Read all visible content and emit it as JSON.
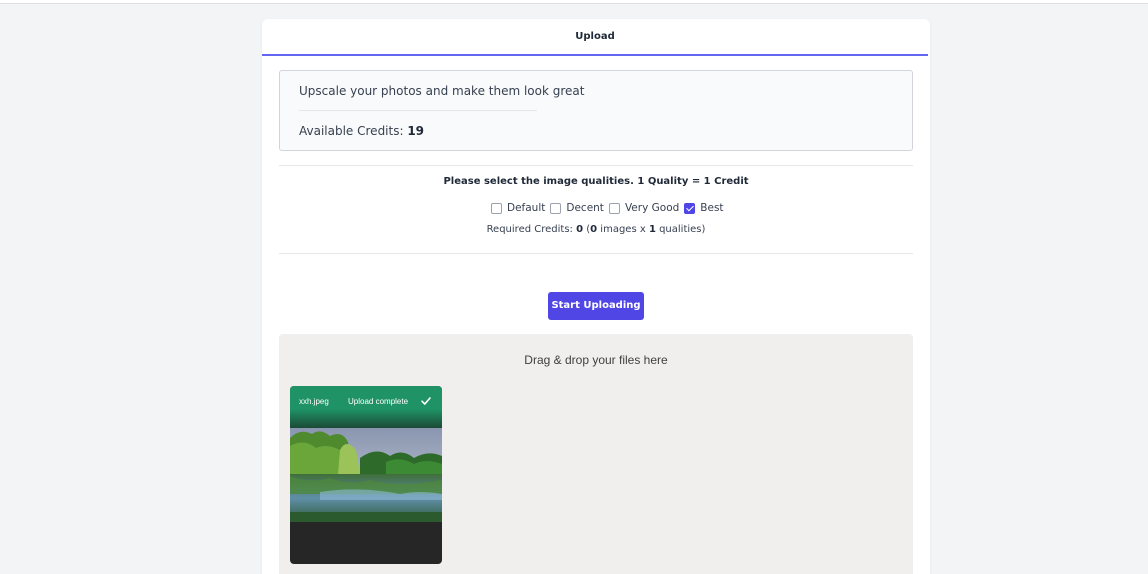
{
  "tabs": [
    {
      "label": "Upload"
    }
  ],
  "info": {
    "title": "Upscale your photos and make them look great",
    "credits_label": "Available Credits: ",
    "credits_value": "19"
  },
  "quality": {
    "heading": "Please select the image qualities. 1 Quality = 1 Credit",
    "options": [
      {
        "label": "Default",
        "checked": false
      },
      {
        "label": "Decent",
        "checked": false
      },
      {
        "label": "Very Good",
        "checked": false
      },
      {
        "label": "Best",
        "checked": true
      }
    ],
    "required": {
      "prefix": "Required Credits: ",
      "credits": "0",
      "open": " (",
      "images": "0",
      "images_text": " images x ",
      "qualities": "1",
      "qualities_text": " qualities)"
    }
  },
  "start_button": {
    "label": "Start Uploading"
  },
  "dropzone": {
    "label": "Drag & drop your files here",
    "files": [
      {
        "name": "xxh.jpeg",
        "status": "Upload complete"
      }
    ]
  },
  "colors": {
    "accent": "#4f46e5",
    "tab_underline": "#6366f1",
    "upload_success": "#1f9365"
  },
  "icons": {
    "file_status": "checkmark-icon"
  }
}
